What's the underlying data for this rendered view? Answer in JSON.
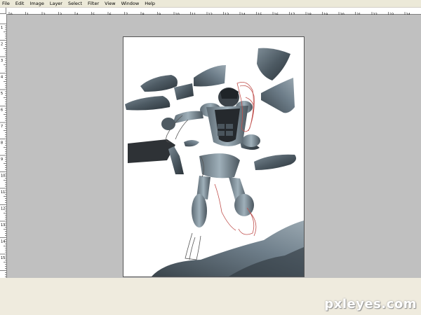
{
  "menubar": {
    "items": [
      "File",
      "Edit",
      "Image",
      "Layer",
      "Select",
      "Filter",
      "View",
      "Window",
      "Help"
    ]
  },
  "rulers": {
    "top_labels": [
      "0",
      "1",
      "2",
      "3",
      "4",
      "5",
      "6",
      "7",
      "8",
      "9",
      "10",
      "11",
      "12",
      "13",
      "14",
      "15",
      "16",
      "17",
      "18",
      "19",
      "20",
      "21",
      "22",
      "23",
      "24",
      "25"
    ],
    "left_labels": [
      "1",
      "2",
      "3",
      "4",
      "5",
      "6",
      "7",
      "8",
      "9",
      "10",
      "11",
      "12",
      "13",
      "14",
      "15"
    ]
  },
  "canvas": {
    "background_color": "#ffffff",
    "workspace_color": "#c0c0c0",
    "artwork": "robot-figure-with-floating-rock-fragments"
  },
  "watermark": {
    "text": "pxleyes.com"
  }
}
